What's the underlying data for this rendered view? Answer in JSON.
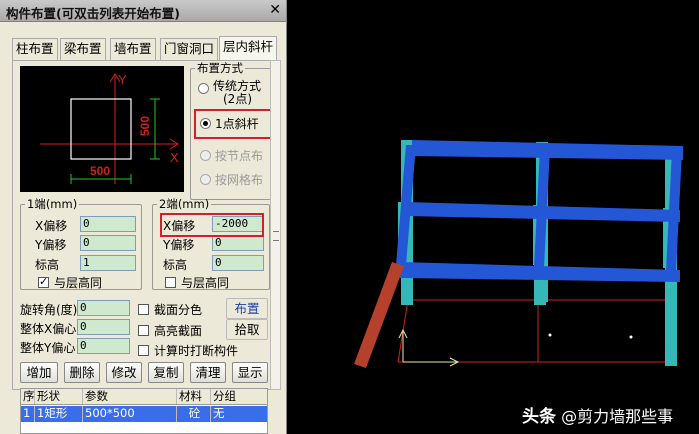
{
  "window": {
    "title": "构件布置(可双击列表开始布置)",
    "close_glyph": "✕"
  },
  "tabs": [
    "柱布置",
    "梁布置",
    "墙布置",
    "门窗洞口",
    "层内斜杆"
  ],
  "preview": {
    "axis_y": "Y",
    "axis_x": "X",
    "height_dim": "500",
    "width_dim": "500"
  },
  "layout_mode": {
    "legend": "布置方式",
    "options": [
      {
        "label": "传统方式",
        "sub": "(2点)",
        "selected": false,
        "enabled": true
      },
      {
        "label": "1点斜杆",
        "selected": true,
        "enabled": true
      },
      {
        "label": "按节点布",
        "selected": false,
        "enabled": false
      },
      {
        "label": "按网格布",
        "selected": false,
        "enabled": false
      }
    ]
  },
  "end1": {
    "legend": "1端(mm)",
    "x_label": "X偏移",
    "x_value": "0",
    "y_label": "Y偏移",
    "y_value": "0",
    "elev_label": "标高",
    "elev_value": "1",
    "same_floor_label": "与层高同",
    "same_floor_checked": true
  },
  "end2": {
    "legend": "2端(mm)",
    "x_label": "X偏移",
    "x_value": "-2000",
    "y_label": "Y偏移",
    "y_value": "0",
    "elev_label": "标高",
    "elev_value": "0",
    "same_floor_label": "与层高同",
    "same_floor_checked": false
  },
  "props": {
    "rotation_label": "旋转角(度)",
    "rotation_value": "0",
    "x_ecc_label": "整体X偏心",
    "x_ecc_value": "0",
    "y_ecc_label": "整体Y偏心",
    "y_ecc_value": "0",
    "section_color_label": "截面分色",
    "highlight_label": "高亮截面",
    "break_calc_label": "计算时打断构件",
    "layout_button": "布置",
    "pick_button": "拾取"
  },
  "toolbar": {
    "add": "增加",
    "delete": "删除",
    "modify": "修改",
    "copy": "复制",
    "clear": "清理",
    "show": "显示"
  },
  "table": {
    "headers": [
      "序",
      "形状",
      "参数",
      "材料",
      "分组"
    ],
    "rows": [
      [
        "1",
        "1矩形",
        "500*500",
        "砼",
        "无"
      ]
    ]
  },
  "watermark": {
    "prefix": "头条",
    "text": "@剪力墙那些事"
  },
  "colors": {
    "beam": "#2457d6",
    "column": "#36b8b8",
    "brace": "#b5402b",
    "grid": "#d21f1f",
    "highlight": "#d31f25"
  }
}
